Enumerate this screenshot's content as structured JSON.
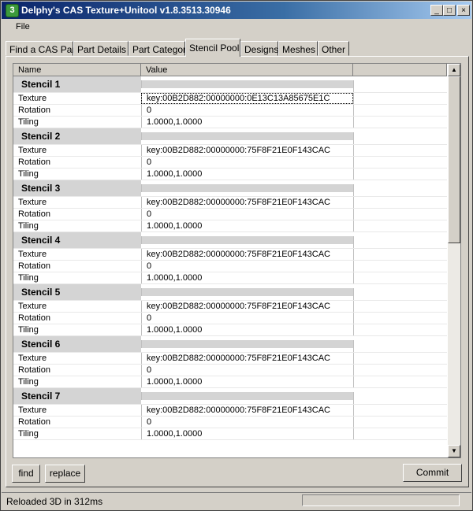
{
  "window": {
    "title": "Delphy's CAS Texture+Unitool v1.8.3513.30946",
    "icon_letter": "3"
  },
  "titlebar_buttons": {
    "minimize": "_",
    "maximize": "□",
    "close": "×"
  },
  "menu": {
    "file": "File"
  },
  "tabs": [
    {
      "label": "Find a CAS Part"
    },
    {
      "label": "Part Details"
    },
    {
      "label": "Part Category"
    },
    {
      "label": "Stencil Pool",
      "active": true
    },
    {
      "label": "Designs"
    },
    {
      "label": "Meshes"
    },
    {
      "label": "Other"
    }
  ],
  "grid": {
    "columns": {
      "name": "Name",
      "value": "Value"
    },
    "stencils": [
      {
        "title": "Stencil 1",
        "texture_label": "Texture",
        "texture": "key:00B2D882:00000000:0E13C13A85675E1C",
        "rotation_label": "Rotation",
        "rotation": "0",
        "tiling_label": "Tiling",
        "tiling": "1.0000,1.0000"
      },
      {
        "title": "Stencil 2",
        "texture_label": "Texture",
        "texture": "key:00B2D882:00000000:75F8F21E0F143CAC",
        "rotation_label": "Rotation",
        "rotation": "0",
        "tiling_label": "Tiling",
        "tiling": "1.0000,1.0000"
      },
      {
        "title": "Stencil 3",
        "texture_label": "Texture",
        "texture": "key:00B2D882:00000000:75F8F21E0F143CAC",
        "rotation_label": "Rotation",
        "rotation": "0",
        "tiling_label": "Tiling",
        "tiling": "1.0000,1.0000"
      },
      {
        "title": "Stencil 4",
        "texture_label": "Texture",
        "texture": "key:00B2D882:00000000:75F8F21E0F143CAC",
        "rotation_label": "Rotation",
        "rotation": "0",
        "tiling_label": "Tiling",
        "tiling": "1.0000,1.0000"
      },
      {
        "title": "Stencil 5",
        "texture_label": "Texture",
        "texture": "key:00B2D882:00000000:75F8F21E0F143CAC",
        "rotation_label": "Rotation",
        "rotation": "0",
        "tiling_label": "Tiling",
        "tiling": "1.0000,1.0000"
      },
      {
        "title": "Stencil 6",
        "texture_label": "Texture",
        "texture": "key:00B2D882:00000000:75F8F21E0F143CAC",
        "rotation_label": "Rotation",
        "rotation": "0",
        "tiling_label": "Tiling",
        "tiling": "1.0000,1.0000"
      },
      {
        "title": "Stencil 7",
        "texture_label": "Texture",
        "texture": "key:00B2D882:00000000:75F8F21E0F143CAC",
        "rotation_label": "Rotation",
        "rotation": "0",
        "tiling_label": "Tiling",
        "tiling": "1.0000,1.0000"
      }
    ]
  },
  "scrollbar": {
    "up": "▲",
    "down": "▼"
  },
  "buttons": {
    "find": "find",
    "replace": "replace",
    "commit": "Commit"
  },
  "status": {
    "text": "Reloaded 3D in 312ms"
  }
}
